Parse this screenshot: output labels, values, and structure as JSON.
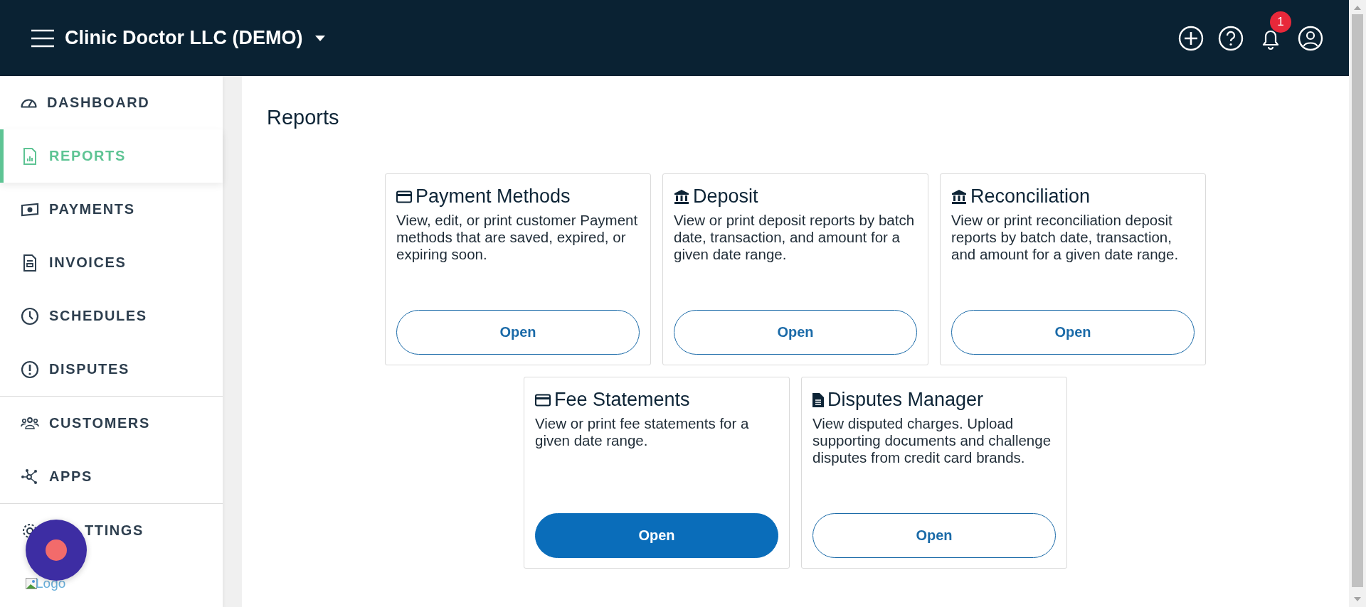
{
  "header": {
    "company": "Clinic Doctor LLC (DEMO)",
    "notification_count": "1"
  },
  "sidebar": {
    "groups": [
      [
        {
          "label": "DASHBOARD",
          "kind": "gauge",
          "selected": false
        },
        {
          "label": "REPORTS",
          "kind": "report",
          "selected": true
        },
        {
          "label": "PAYMENTS",
          "kind": "cash",
          "selected": false
        },
        {
          "label": "INVOICES",
          "kind": "invoice",
          "selected": false
        },
        {
          "label": "SCHEDULES",
          "kind": "clock",
          "selected": false
        },
        {
          "label": "DISPUTES",
          "kind": "alert",
          "selected": false
        }
      ],
      [
        {
          "label": "CUSTOMERS",
          "kind": "people",
          "selected": false
        },
        {
          "label": "APPS",
          "kind": "network",
          "selected": false
        }
      ],
      [
        {
          "label": "TTINGS",
          "kind": "gear",
          "selected": false
        }
      ]
    ],
    "logo_alt": "Logo"
  },
  "page": {
    "title": "Reports"
  },
  "report_rows": [
    [
      {
        "title": "Payment Methods",
        "kind": "card",
        "description": "View, edit, or print customer Payment methods that are saved, expired, or expiring soon.",
        "button": "Open",
        "highlighted": false
      },
      {
        "title": "Deposit",
        "kind": "bank",
        "description": "View or print deposit reports by batch date, transaction, and amount for a given date range.",
        "button": "Open",
        "highlighted": false
      },
      {
        "title": "Reconciliation",
        "kind": "bank",
        "description": "View or print reconciliation deposit reports by batch date, transaction, and amount for a given date range.",
        "button": "Open",
        "highlighted": false
      }
    ],
    [
      {
        "title": "Fee Statements",
        "kind": "card",
        "description": "View or print fee statements for a given date range.",
        "button": "Open",
        "highlighted": true
      },
      {
        "title": "Disputes Manager",
        "kind": "document",
        "description": "View disputed charges. Upload supporting documents and challenge disputes from credit card brands.",
        "button": "Open",
        "highlighted": false
      }
    ]
  ]
}
